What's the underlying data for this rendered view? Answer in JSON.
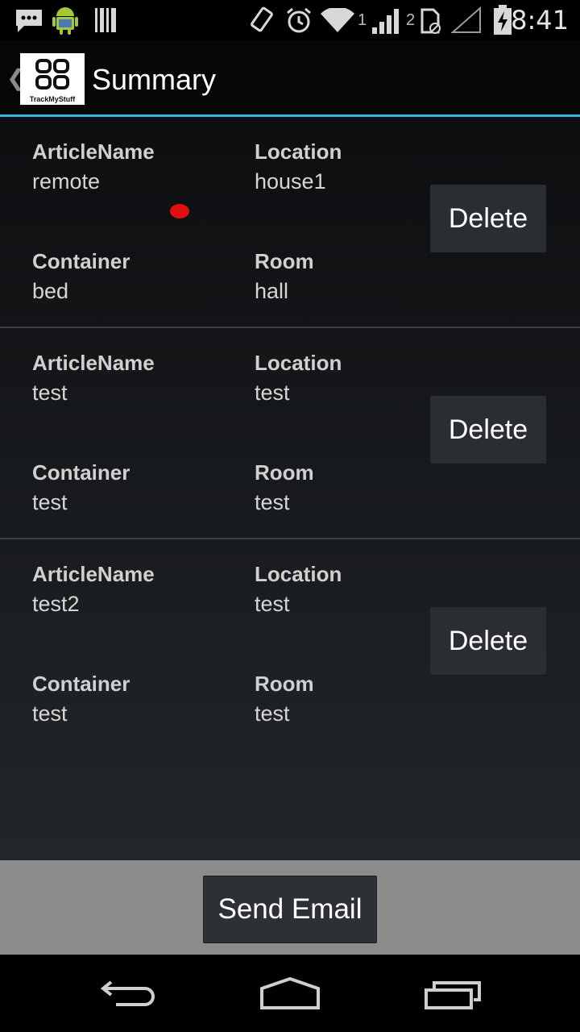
{
  "status_bar": {
    "time": "8:41",
    "icons": [
      "message-icon",
      "android-icon",
      "barcode-icon",
      "rotate-icon",
      "alarm-icon",
      "wifi-icon",
      "signal-1-icon",
      "signal-2-icon",
      "no-sim-icon",
      "battery-charging-icon"
    ],
    "sim1_label": "1",
    "sim2_label": "2"
  },
  "action_bar": {
    "title": "Summary",
    "logo_caption": "TrackMyStuff"
  },
  "items": [
    {
      "article_label": "ArticleName",
      "article_value": "remote",
      "location_label": "Location",
      "location_value": "house1",
      "container_label": "Container",
      "container_value": "bed",
      "room_label": "Room",
      "room_value": "hall",
      "delete_label": "Delete"
    },
    {
      "article_label": "ArticleName",
      "article_value": "test",
      "location_label": "Location",
      "location_value": "test",
      "container_label": "Container",
      "container_value": "test",
      "room_label": "Room",
      "room_value": "test",
      "delete_label": "Delete"
    },
    {
      "article_label": "ArticleName",
      "article_value": "test2",
      "location_label": "Location",
      "location_value": "test",
      "container_label": "Container",
      "container_value": "test",
      "room_label": "Room",
      "room_value": "test",
      "delete_label": "Delete"
    }
  ],
  "footer": {
    "send_email_label": "Send Email"
  },
  "colors": {
    "accent": "#33b5e5",
    "background": "#1a1c1f",
    "footer": "#8c8c8c",
    "touch_indicator": "#e30e0e"
  },
  "nav_bar": {
    "icons": [
      "back-icon",
      "home-icon",
      "recents-icon"
    ]
  }
}
